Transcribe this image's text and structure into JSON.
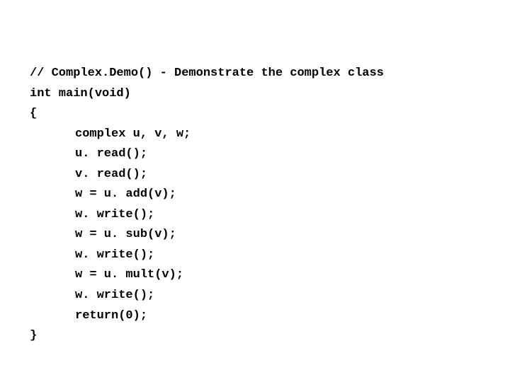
{
  "code": {
    "lines": [
      "// Complex.Demo() - Demonstrate the complex class",
      "int main(void)",
      "{",
      "complex u, v, w;",
      "u. read();",
      "v. read();",
      "w = u. add(v);",
      "w. write();",
      "w = u. sub(v);",
      "w. write();",
      "w = u. mult(v);",
      "w. write();",
      "return(0);",
      "}"
    ],
    "indented": [
      false,
      false,
      false,
      true,
      true,
      true,
      true,
      true,
      true,
      true,
      true,
      true,
      true,
      false
    ]
  }
}
